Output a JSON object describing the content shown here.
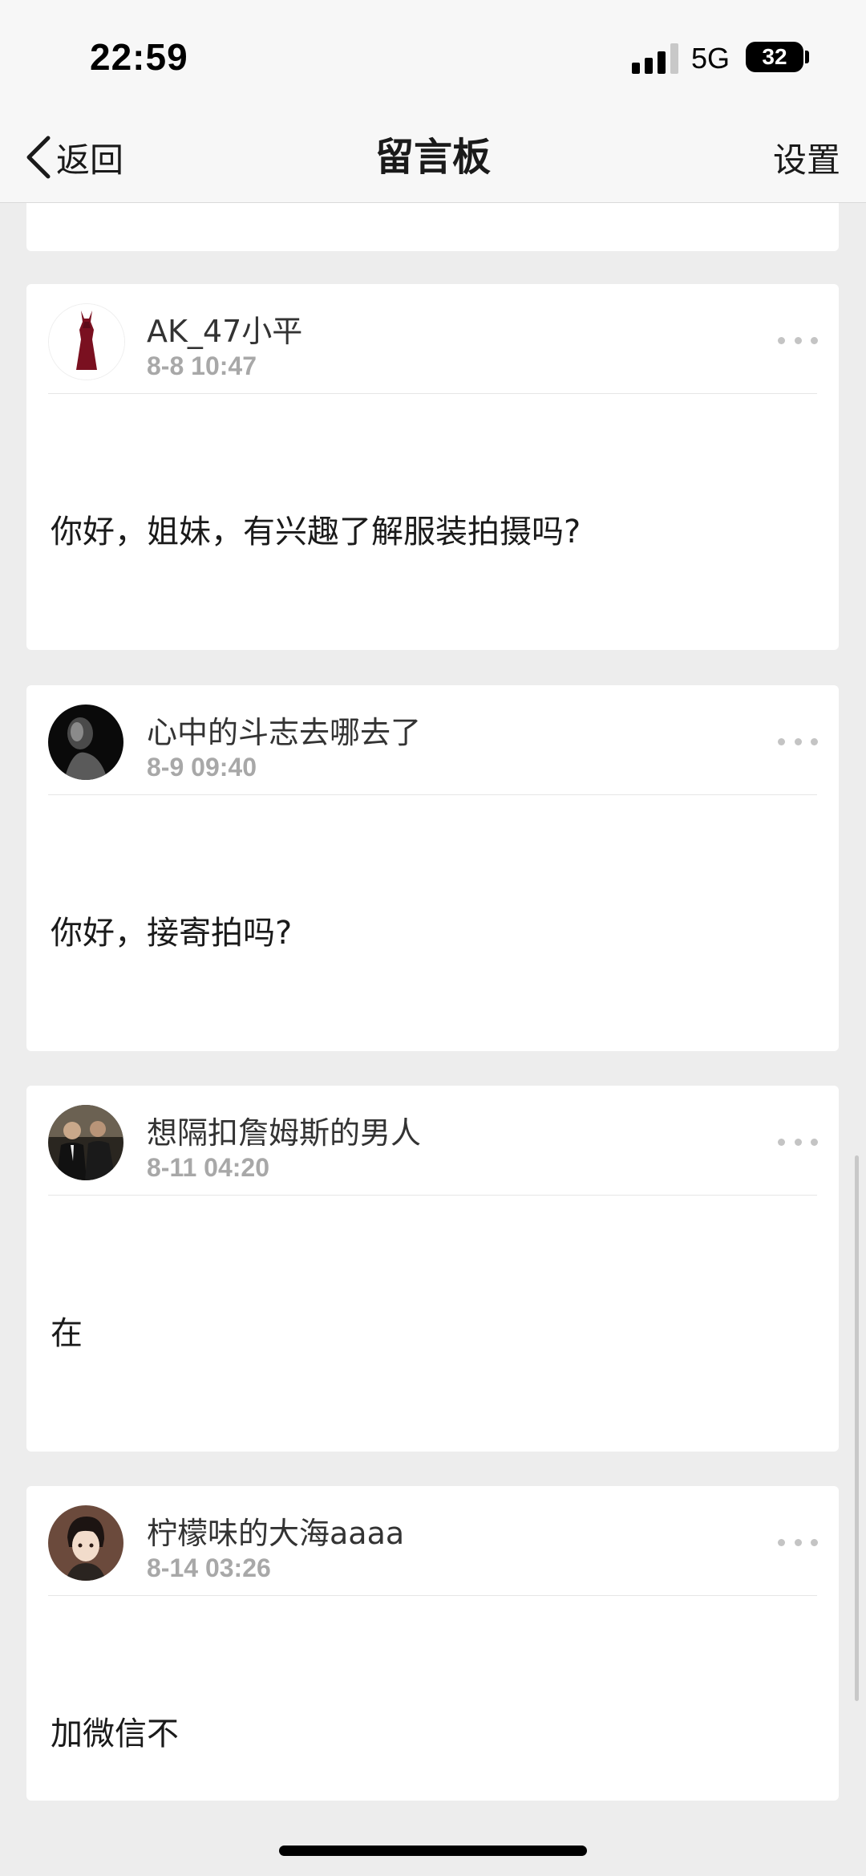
{
  "status_bar": {
    "time": "22:59",
    "network": "5G",
    "battery": "32"
  },
  "nav": {
    "back_label": "返回",
    "title": "留言板",
    "settings_label": "设置"
  },
  "messages": [
    {
      "username": "AK_47小平",
      "time": "8-8 10:47",
      "text": "你好，姐妹，有兴趣了解服装拍摄吗?"
    },
    {
      "username": "心中的斗志去哪去了",
      "time": "8-9 09:40",
      "text": "你好，接寄拍吗?"
    },
    {
      "username": "想隔扣詹姆斯的男人",
      "time": "8-11 04:20",
      "text": "在"
    },
    {
      "username": "柠檬味的大海aaaa",
      "time": "8-14 03:26",
      "text": "加微信不"
    }
  ]
}
